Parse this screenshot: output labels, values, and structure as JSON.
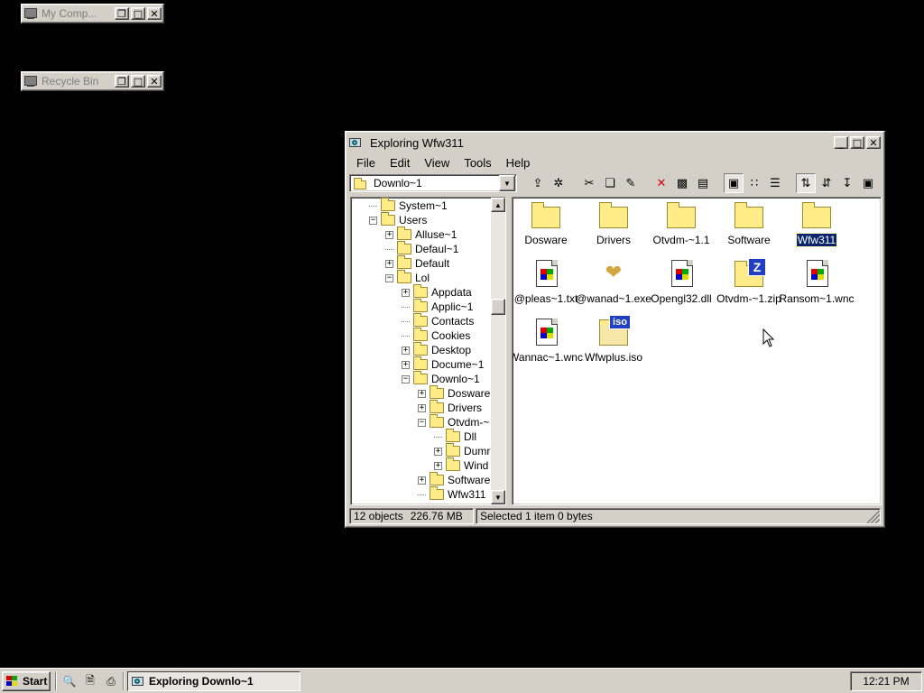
{
  "desktop": {
    "minimized_windows": [
      {
        "title": "My Comp..."
      },
      {
        "title": "Recycle Bin"
      }
    ]
  },
  "explorer": {
    "title": "Exploring Wfw311",
    "menu": [
      "File",
      "Edit",
      "View",
      "Tools",
      "Help"
    ],
    "address": "Downlo~1",
    "tree": [
      {
        "label": "System~1",
        "level": 1,
        "toggle": "none"
      },
      {
        "label": "Users",
        "level": 1,
        "toggle": "minus"
      },
      {
        "label": "Alluse~1",
        "level": 2,
        "toggle": "plus"
      },
      {
        "label": "Defaul~1",
        "level": 2,
        "toggle": "none"
      },
      {
        "label": "Default",
        "level": 2,
        "toggle": "plus"
      },
      {
        "label": "Lol",
        "level": 2,
        "toggle": "minus"
      },
      {
        "label": "Appdata",
        "level": 3,
        "toggle": "plus"
      },
      {
        "label": "Applic~1",
        "level": 3,
        "toggle": "none"
      },
      {
        "label": "Contacts",
        "level": 3,
        "toggle": "none"
      },
      {
        "label": "Cookies",
        "level": 3,
        "toggle": "none"
      },
      {
        "label": "Desktop",
        "level": 3,
        "toggle": "plus"
      },
      {
        "label": "Docume~1",
        "level": 3,
        "toggle": "plus"
      },
      {
        "label": "Downlo~1",
        "level": 3,
        "toggle": "minus"
      },
      {
        "label": "Dosware",
        "level": 4,
        "toggle": "plus"
      },
      {
        "label": "Drivers",
        "level": 4,
        "toggle": "plus"
      },
      {
        "label": "Otvdm-~",
        "level": 4,
        "toggle": "minus"
      },
      {
        "label": "Dll",
        "level": 5,
        "toggle": "none"
      },
      {
        "label": "Dumr",
        "level": 5,
        "toggle": "plus"
      },
      {
        "label": "Wind",
        "level": 5,
        "toggle": "plus"
      },
      {
        "label": "Software",
        "level": 4,
        "toggle": "plus"
      },
      {
        "label": "Wfw311",
        "level": 4,
        "toggle": "none"
      }
    ],
    "files": [
      {
        "name": "Dosware",
        "icon": "folder-icon"
      },
      {
        "name": "Drivers",
        "icon": "folder-icon"
      },
      {
        "name": "Otvdm-~1.1",
        "icon": "folder-icon"
      },
      {
        "name": "Software",
        "icon": "folder-icon"
      },
      {
        "name": "Wfw311",
        "icon": "folder-icon",
        "selected": true
      },
      {
        "name": "@pleas~1.txt",
        "icon": "windows-file-icon"
      },
      {
        "name": "@wanad~1.exe",
        "icon": "handshake-icon"
      },
      {
        "name": "Opengl32.dll",
        "icon": "windows-file-icon"
      },
      {
        "name": "Otvdm-~1.zip",
        "icon": "zip-folder-icon"
      },
      {
        "name": "Ransom~1.wnc",
        "icon": "windows-file-icon"
      },
      {
        "name": "Wannac~1.wnc",
        "icon": "windows-file-icon"
      },
      {
        "name": "Wfwplus.iso",
        "icon": "iso-file-icon"
      }
    ],
    "status": {
      "objects": "12 objects",
      "size": "226.76 MB",
      "selection": "Selected 1 item  0 bytes"
    }
  },
  "taskbar": {
    "start_label": "Start",
    "task_label": "Exploring Downlo~1",
    "clock": "12:21 PM"
  }
}
